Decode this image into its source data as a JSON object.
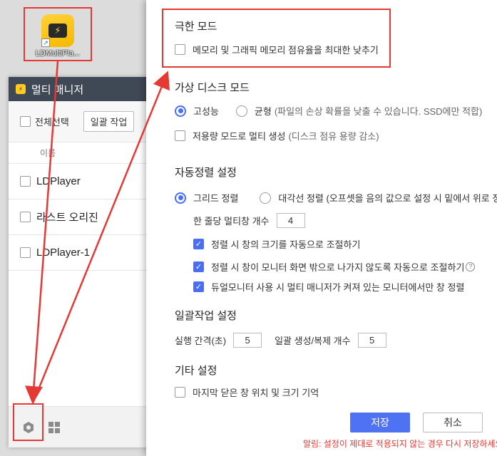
{
  "desktop_icon": {
    "caption": "LDMultiPla...",
    "glyph": "⚡",
    "shortcut_glyph": "↗"
  },
  "multi_manager": {
    "title": "멀티 매니저",
    "select_all_label": "전체선택",
    "batch_button": "일괄 작업",
    "column_name": "이름",
    "rows": [
      {
        "name": "LDPlayer"
      },
      {
        "name": "라스트 오리진"
      },
      {
        "name": "LDPlayer-1"
      }
    ]
  },
  "settings": {
    "extreme_mode": {
      "title": "극한 모드",
      "option": "메모리 및 그래픽 메모리 점유율을 최대한 낮추기"
    },
    "virtual_disk": {
      "title": "가상 디스크 모드",
      "high_perf": "고성능",
      "balanced": "균형",
      "balanced_note": "(파일의 손상 확률을 낮출 수 있습니다. SSD에만 적합)",
      "low_capacity": "저용량 모드로 멀티 생성",
      "low_capacity_note": "(디스크 점유 용량 감소)"
    },
    "auto_arrange": {
      "title": "자동정렬 설정",
      "grid": "그리드 정렬",
      "diagonal": "대각선 정렬 (오프셋을 음의 값으로 설정 시 밑에서 위로 정렬)",
      "per_row_label": "한 줄당 멀티창 개수",
      "per_row_value": "4",
      "opt_resize": "정렬 시 창의 크기를 자동으로 조절하기",
      "opt_keep_inside": "정렬 시 창이 모니터 화면 밖으로 나가지 않도록 자동으로 조절하기",
      "help_glyph": "?",
      "opt_dual_monitor": "듀얼모니터 사용 시 멀티 매니저가 켜져 있는 모니터에서만 창 정렬"
    },
    "batch": {
      "title": "일괄작업 설정",
      "interval_label": "실행 간격(초)",
      "interval_value": "5",
      "count_label": "일괄 생성/복제 개수",
      "count_value": "5"
    },
    "other": {
      "title": "기타 설정",
      "remember_window": "마지막 닫은 창 위치 및 크기 기억"
    },
    "save_button": "저장",
    "cancel_button": "취소",
    "notice": "알림: 설정이 제대로 적용되지 않는 경우 다시 저장하세요."
  },
  "colors": {
    "accent": "#4f72f2",
    "highlight": "#e53935",
    "title_bar": "#3f4855"
  }
}
